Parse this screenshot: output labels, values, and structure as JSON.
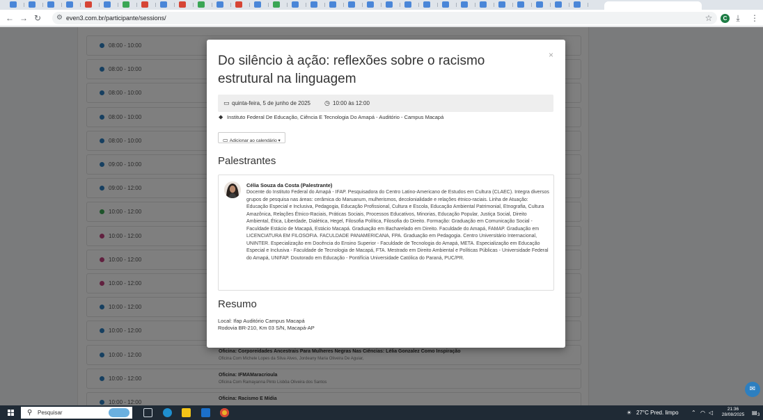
{
  "browser": {
    "url": "even3.com.br/participante/sessions/",
    "profile_initial": "C"
  },
  "sessions": [
    {
      "time": "08:00 - 10:00",
      "color": "#2d7fc0",
      "title": "",
      "subtitle": ""
    },
    {
      "time": "08:00 - 10:00",
      "color": "#2d7fc0",
      "title": "",
      "subtitle": ""
    },
    {
      "time": "08:00 - 10:00",
      "color": "#2d7fc0",
      "title": "",
      "subtitle": ""
    },
    {
      "time": "08:00 - 10:00",
      "color": "#2d7fc0",
      "title": "",
      "subtitle": ""
    },
    {
      "time": "08:00 - 10:00",
      "color": "#2d7fc0",
      "title": "",
      "subtitle": ""
    },
    {
      "time": "09:00 - 10:00",
      "color": "#2d7fc0",
      "title": "",
      "subtitle": ""
    },
    {
      "time": "09:00 - 12:00",
      "color": "#2d7fc0",
      "title": "",
      "subtitle": ""
    },
    {
      "time": "10:00 - 12:00",
      "color": "#3aa655",
      "title": "",
      "subtitle": ""
    },
    {
      "time": "10:00 - 12:00",
      "color": "#c2417e",
      "title": "",
      "subtitle": ""
    },
    {
      "time": "10:00 - 12:00",
      "color": "#c2417e",
      "title": "",
      "subtitle": ""
    },
    {
      "time": "10:00 - 12:00",
      "color": "#c2417e",
      "title": "",
      "subtitle": ""
    },
    {
      "time": "10:00 - 12:00",
      "color": "#2d7fc0",
      "title": "",
      "subtitle": ""
    },
    {
      "time": "10:00 - 12:00",
      "color": "#2d7fc0",
      "title": "",
      "subtitle": ""
    },
    {
      "time": "10:00 - 12:00",
      "color": "#2d7fc0",
      "title": "Oficina: Corporeidades Ancestrais Para Mulheres Negras Nas Ciências: Lélia Gonzalez Como Inspiração",
      "subtitle": "Oficina Com Michele Lopes da Silva Alves, Jordeany Maria Oliveira De Aguiar,"
    },
    {
      "time": "10:00 - 12:00",
      "color": "#2d7fc0",
      "title": "Oficina: IFMAMaracrioula",
      "subtitle": "Oficina Com Ramayanna Pinto Lisbôa Oliveira dos Santos"
    },
    {
      "time": "10:00 - 12:00",
      "color": "#2d7fc0",
      "title": "Oficina: Racismo E Mídia",
      "subtitle": ""
    }
  ],
  "modal": {
    "title": "Do silêncio à ação: reflexões sobre o racismo estrutural na linguagem",
    "close": "×",
    "date": "quinta-feira, 5 de junho de 2025",
    "hours": "10:00 às 12:00",
    "location": "Instituto Federal De Educação, Ciência E Tecnologia Do Amapá - Auditório - Campus Macapá",
    "calendar_button": "Adicionar ao calendário ▾",
    "speakers_heading": "Palestrantes",
    "speaker": {
      "name": "Célia Souza da Costa (Palestrante)",
      "bio": "Docente do Instituto Federal do Amapá - IFAP. Pesquisadora do Centro Latino-Americano de Estudos em Cultura (CLAEC). Integra diversos grupos de pesquisa nas áreas: cerâmica do Maruanum, mulherismos, decolonialidade e relações étnico-raciais. Linha de Atuação: Educação Especial e Inclusiva, Pedagogia, Educação Profissional, Cultura e Escola, Educação Ambiental Patrimonial, Etnografia, Cultura Amazônica, Relações Étnico-Raciais, Práticas Sociais, Processos Educativos, Minorias, Educação Popular, Justiça Social, Direito Ambiental, Ética, Liberdade, Dialética, Hegel, Filosofia Política, Filosofia do Direito. Formação: Graduação em Comunicação Social - Faculdade Estácio de Macapá, Estácio Macapá. Graduação em Bacharelado em Direito. Faculdade do Amapá, FAMAP. Graduação em LICENCIATURA EM FILOSOFIA. FACULDADE PANAMERICANA, FPA. Graduação em Pedagogia. Centro Universitário Internacional, UNINTER. Especialização em Docência do Ensino Superior - Faculdade de Tecnologia do Amapá, META. Especialização em Educação Especial e Inclusiva - Faculdade de Tecnologia de Macapá, FTA. Mestrado em Direito Ambiental e Políticas Públicas - Universidade Federal do Amapá, UNIFAP. Doutorado em Educação - Pontifícia Universidade Católica do Paraná, PUC/PR."
    },
    "summary_heading": "Resumo",
    "summary_line1": "Local: Ifap Auditório Campus Macapá",
    "summary_line2": "Rodovia BR-210, Km 03 S/N, Macapá-AP"
  },
  "taskbar": {
    "search_placeholder": "Pesquisar",
    "weather": "27°C  Pred. limpo",
    "time": "21:36",
    "date": "28/08/2025",
    "notification_count": "3"
  }
}
